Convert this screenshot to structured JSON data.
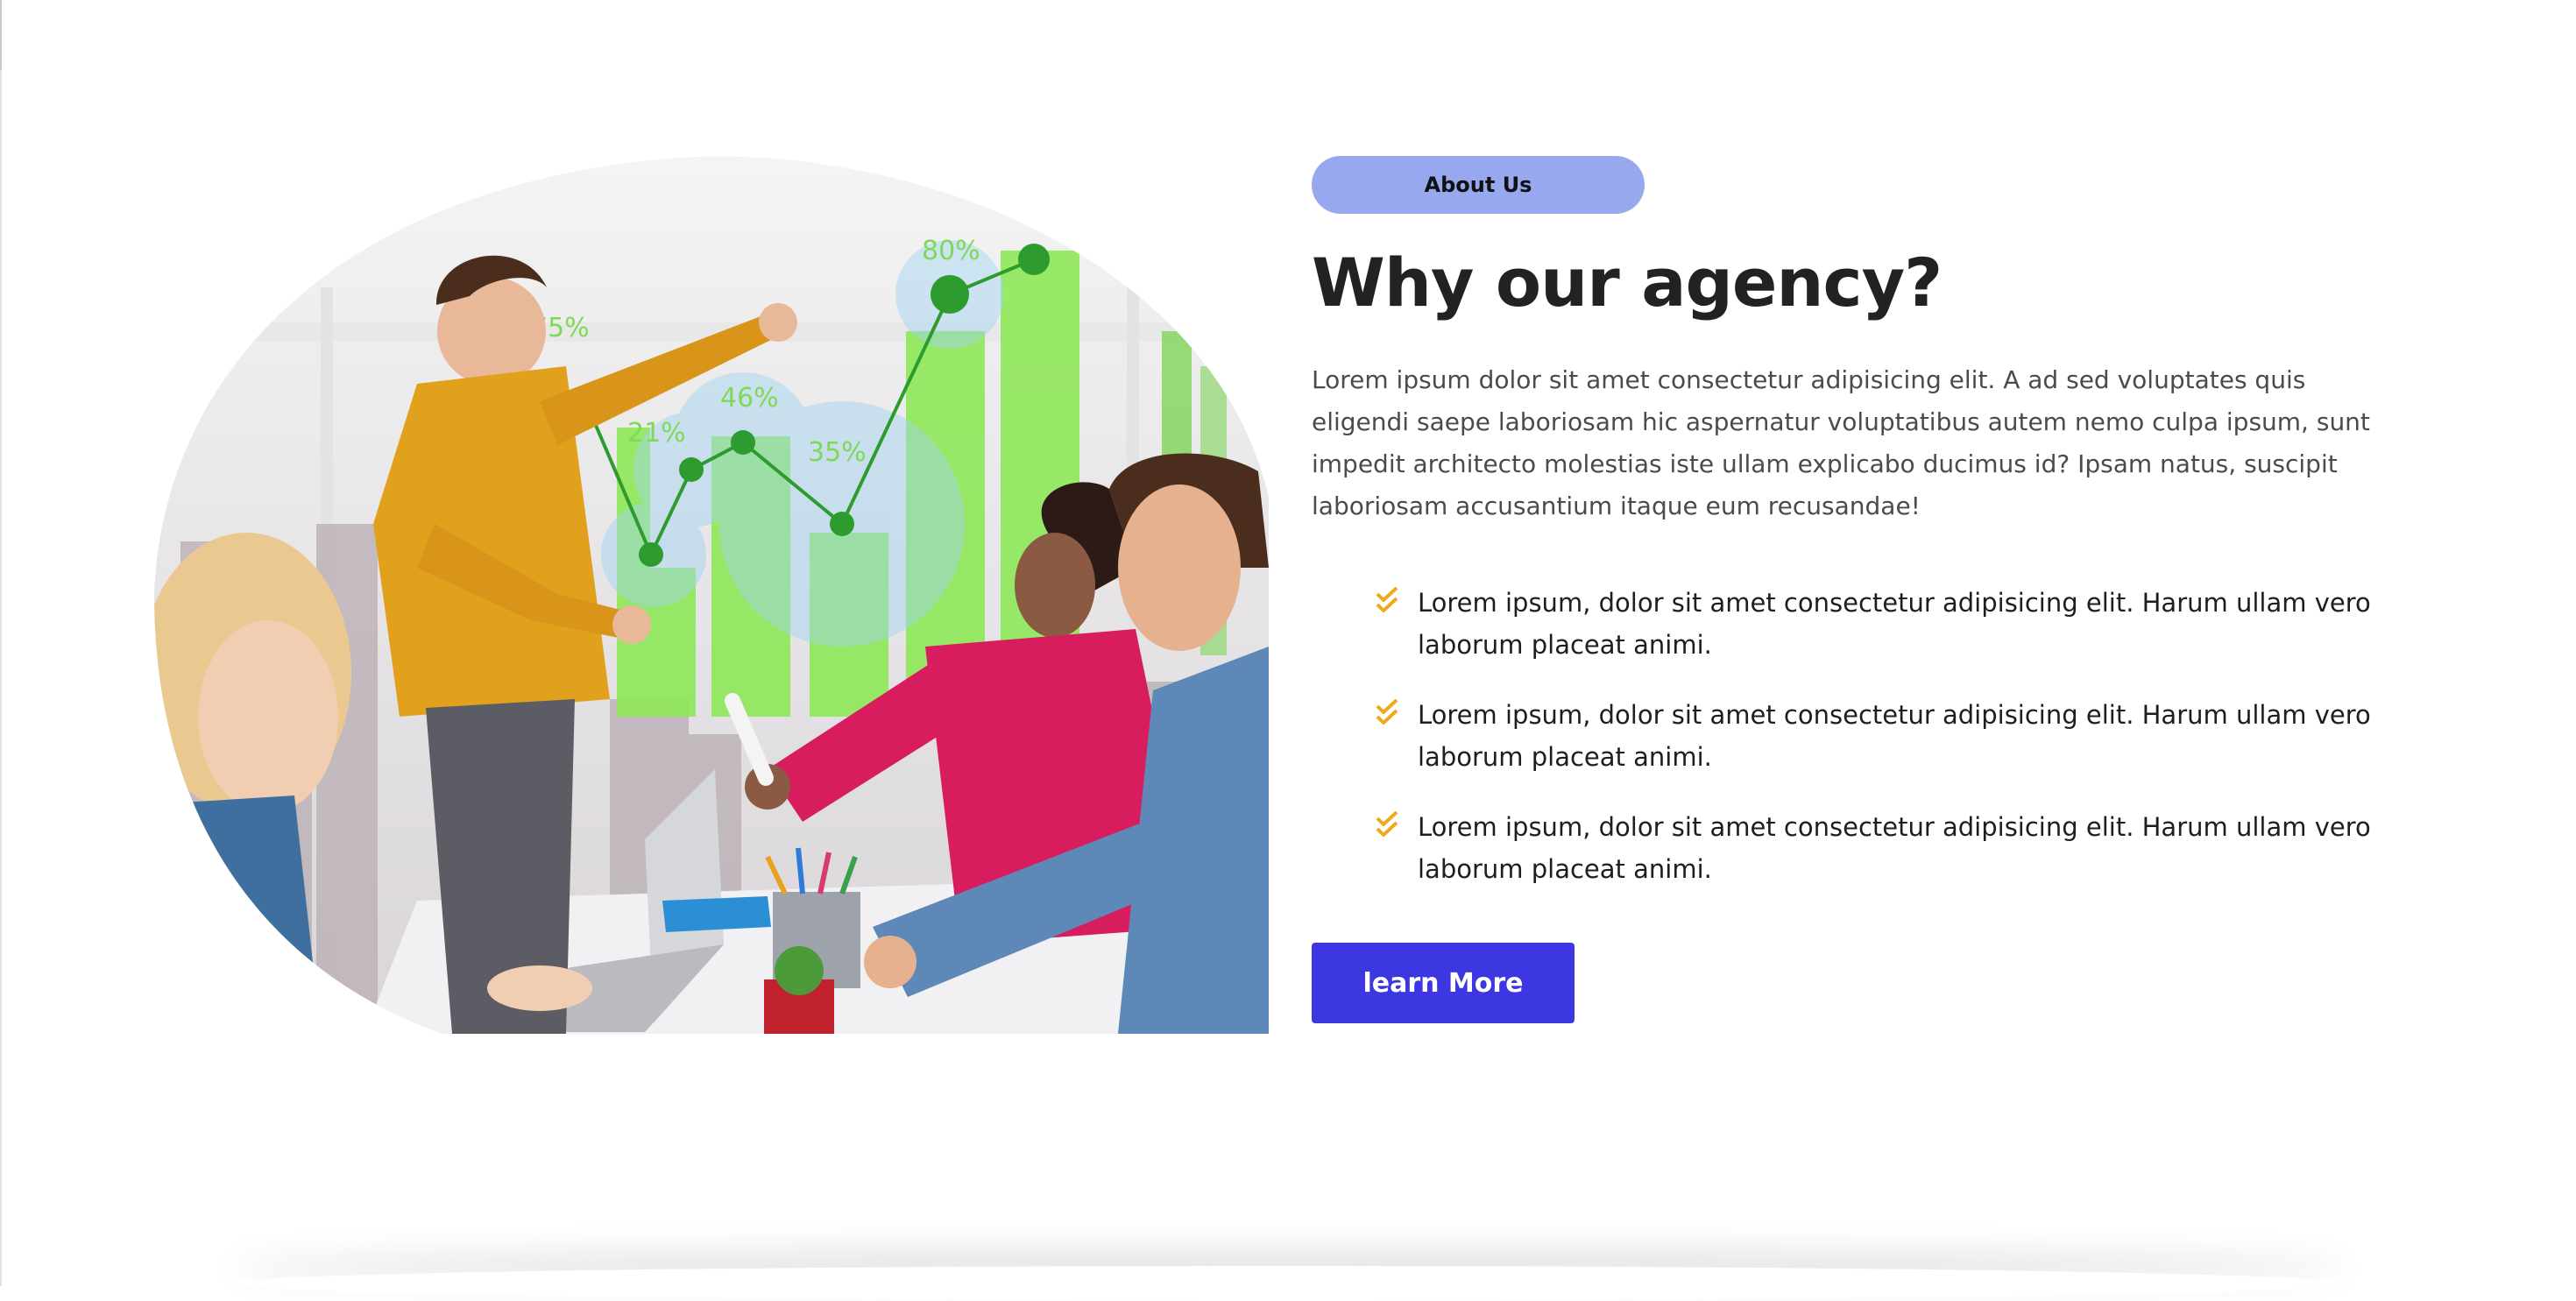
{
  "about": {
    "badge_label": "About Us",
    "title": "Why our agency?",
    "intro": "Lorem ipsum dolor sit amet consectetur adipisicing elit. A ad sed voluptates quis eligendi saepe laboriosam hic aspernatur voluptatibus autem nemo culpa ipsum, sunt impedit architecto molestias iste ullam explicabo ducimus id? Ipsam natus, suscipit laboriosam accusantium itaque eum recusandae!",
    "features": [
      "Lorem ipsum, dolor sit amet consectetur adipisicing elit. Harum ullam vero laborum placeat animi.",
      "Lorem ipsum, dolor sit amet consectetur adipisicing elit. Harum ullam vero laborum placeat animi.",
      "Lorem ipsum, dolor sit amet consectetur adipisicing elit. Harum ullam vero laborum placeat animi."
    ],
    "cta_label": "learn More",
    "check_icon": "double-check-icon"
  },
  "photo": {
    "subject": "team-meeting-photo",
    "chart_labels": [
      "75%",
      "21%",
      "46%",
      "35%",
      "80%"
    ]
  },
  "colors": {
    "badge_bg": "#98a8ee",
    "badge_text": "#111111",
    "heading": "#222222",
    "accent_button": "#3c37e0",
    "check": "#f2a81d",
    "chart_green": "#8fe85a"
  }
}
